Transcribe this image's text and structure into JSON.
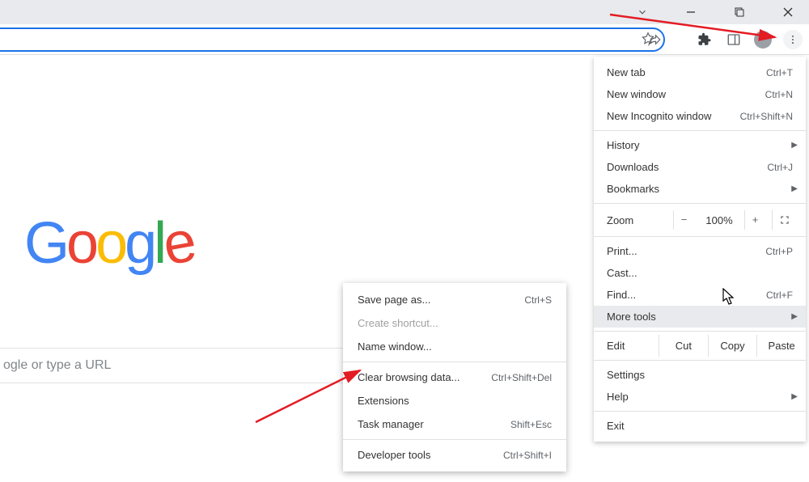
{
  "titlebar": {},
  "omnibox": {
    "placeholder": ""
  },
  "search": {
    "placeholder": "ogle or type a URL"
  },
  "menu": {
    "new_tab": {
      "label": "New tab",
      "shortcut": "Ctrl+T"
    },
    "new_window": {
      "label": "New window",
      "shortcut": "Ctrl+N"
    },
    "new_incognito": {
      "label": "New Incognito window",
      "shortcut": "Ctrl+Shift+N"
    },
    "history": {
      "label": "History"
    },
    "downloads": {
      "label": "Downloads",
      "shortcut": "Ctrl+J"
    },
    "bookmarks": {
      "label": "Bookmarks"
    },
    "zoom": {
      "label": "Zoom",
      "pct": "100%"
    },
    "print": {
      "label": "Print...",
      "shortcut": "Ctrl+P"
    },
    "cast": {
      "label": "Cast..."
    },
    "find": {
      "label": "Find...",
      "shortcut": "Ctrl+F"
    },
    "more_tools": {
      "label": "More tools"
    },
    "edit": {
      "label": "Edit",
      "cut": "Cut",
      "copy": "Copy",
      "paste": "Paste"
    },
    "settings": {
      "label": "Settings"
    },
    "help": {
      "label": "Help"
    },
    "exit": {
      "label": "Exit"
    }
  },
  "submenu": {
    "save_page": {
      "label": "Save page as...",
      "shortcut": "Ctrl+S"
    },
    "create_shortcut": {
      "label": "Create shortcut..."
    },
    "name_window": {
      "label": "Name window..."
    },
    "clear_browsing": {
      "label": "Clear browsing data...",
      "shortcut": "Ctrl+Shift+Del"
    },
    "extensions": {
      "label": "Extensions"
    },
    "task_manager": {
      "label": "Task manager",
      "shortcut": "Shift+Esc"
    },
    "developer_tools": {
      "label": "Developer tools",
      "shortcut": "Ctrl+Shift+I"
    }
  }
}
